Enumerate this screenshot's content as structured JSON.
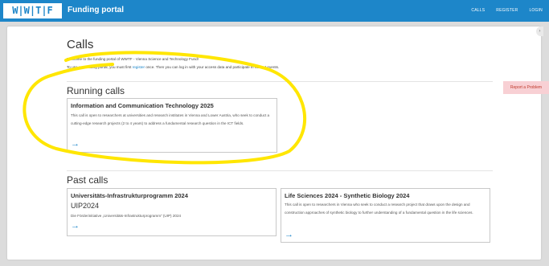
{
  "header": {
    "logo": "W|W|T|F",
    "title": "Funding portal",
    "nav": [
      "CALLS",
      "REGISTER",
      "LOGIN"
    ]
  },
  "page": {
    "heading": "Calls",
    "welcome_line1": "Welcome to the funding portal of WWTF - Vienna Science and Technology Fund!",
    "welcome_line2_a": "To use our funding portal, you must first ",
    "welcome_link": "register",
    "welcome_line2_b": " once. Then you can log in with your access data and participate in current events."
  },
  "running": {
    "section_title": "Running calls",
    "calls": [
      {
        "title": "Information and Communication Technology 2025",
        "description": "This call is open to researchers at universities and research institutes in Vienna and Lower Austria, who seek to conduct a cutting-edge research projects (2 to 4 years) to address a fundamental research question in the ICT fields.",
        "arrow": "→"
      }
    ]
  },
  "past": {
    "section_title": "Past calls",
    "calls": [
      {
        "title": "Universitäts-Infrastrukturprogramm 2024",
        "subtitle": "UIP2024",
        "description": "Die Förderinitiative „Universitäts-Infrastrukturprogramm“ (UIP) 2024",
        "arrow": "→"
      },
      {
        "title": "Life Sciences 2024 - Synthetic Biology 2024",
        "description": "This call is open to researchers in Vienna who seek to conduct a research project that draws upon the design and construction approaches of synthetic biology to further understanding of a fundamental question in the life sciences.",
        "arrow": "→"
      }
    ]
  },
  "report_button": "Report a Problem",
  "colors": {
    "brand": "#1d86c9",
    "highlight": "#ffe600",
    "report_bg": "#f8d0d4"
  }
}
